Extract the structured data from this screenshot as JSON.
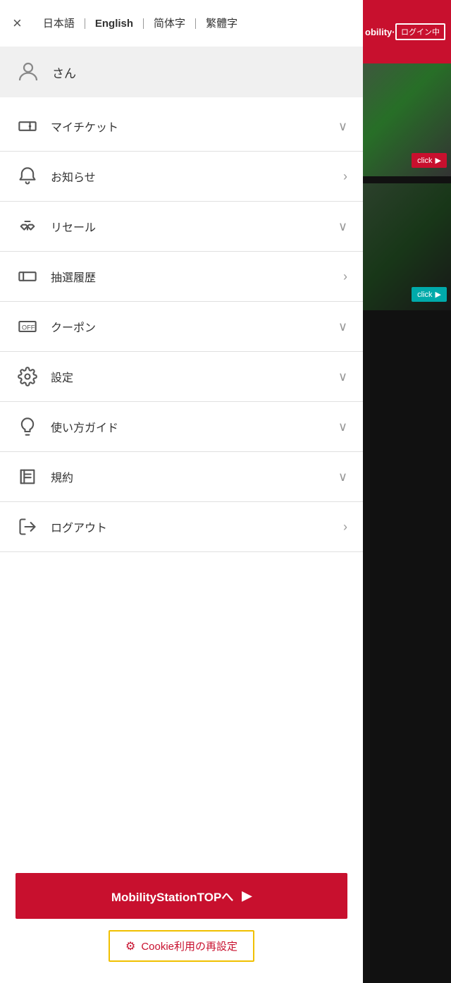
{
  "lang_bar": {
    "close_label": "×",
    "languages": [
      {
        "id": "ja",
        "label": "日本語",
        "active": false
      },
      {
        "id": "en",
        "label": "English",
        "active": true
      },
      {
        "id": "zh_s",
        "label": "简体字",
        "active": false
      },
      {
        "id": "zh_t",
        "label": "繁體字",
        "active": false
      }
    ]
  },
  "user": {
    "name": "さん"
  },
  "menu_items": [
    {
      "id": "my_ticket",
      "label": "マイチケット",
      "arrow": "chevron-down",
      "icon": "ticket"
    },
    {
      "id": "notice",
      "label": "お知らせ",
      "arrow": "chevron-right",
      "icon": "bell"
    },
    {
      "id": "resale",
      "label": "リセール",
      "arrow": "chevron-down",
      "icon": "handshake"
    },
    {
      "id": "lottery",
      "label": "抽選履歴",
      "arrow": "chevron-right",
      "icon": "ticket"
    },
    {
      "id": "coupon",
      "label": "クーポン",
      "arrow": "chevron-down",
      "icon": "coupon"
    },
    {
      "id": "settings",
      "label": "設定",
      "arrow": "chevron-down",
      "icon": "gear"
    },
    {
      "id": "guide",
      "label": "使い方ガイド",
      "arrow": "chevron-down",
      "icon": "bulb"
    },
    {
      "id": "terms",
      "label": "規約",
      "arrow": "chevron-down",
      "icon": "book"
    },
    {
      "id": "logout",
      "label": "ログアウト",
      "arrow": "chevron-right",
      "icon": "logout"
    }
  ],
  "mobility_btn": {
    "label": "MobilityStationTOPへ",
    "arrow": "▶"
  },
  "cookie_btn": {
    "label": "Cookie利用の再設定"
  },
  "right_panel": {
    "title": "obility···",
    "login_status": "ログイン中",
    "click_label1": "click",
    "click_label2": "click"
  }
}
